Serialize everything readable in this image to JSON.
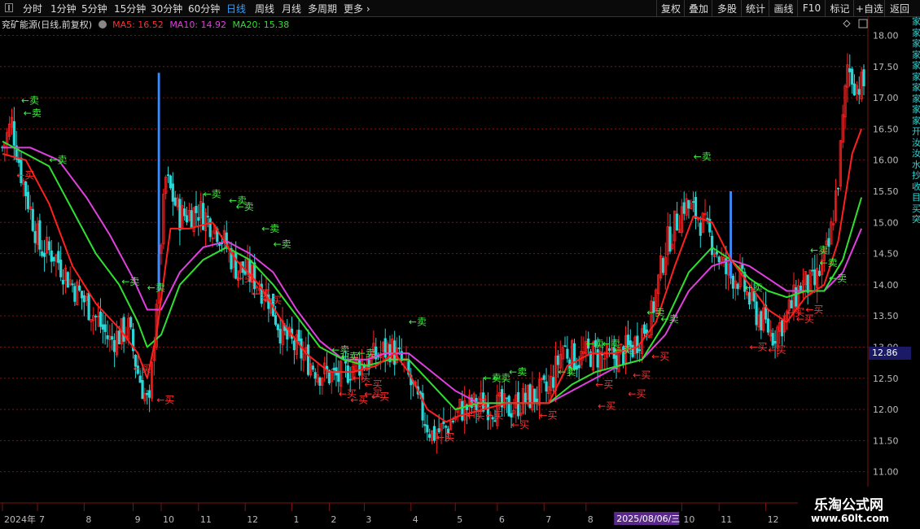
{
  "toolbar": {
    "timeframes": [
      "分时",
      "1分钟",
      "5分钟",
      "15分钟",
      "30分钟",
      "60分钟",
      "日线",
      "周线",
      "月线",
      "多周期",
      "更多 ›"
    ],
    "active_index": 6,
    "right_buttons": [
      "复权",
      "叠加",
      "多股",
      "统计",
      "画线",
      "F10",
      "标记",
      "+自选",
      "返回"
    ]
  },
  "info": {
    "title": "兖矿能源(日线,前复权)",
    "ma5_label": "MA5: 16.52",
    "ma10_label": "MA10: 14.92",
    "ma20_label": "MA20: 15.38"
  },
  "colors": {
    "up": "#ff2020",
    "down": "#2bd6d6",
    "ma5": "#ff2020",
    "ma10": "#e040e0",
    "ma20": "#30e030",
    "buy": "#ff3030",
    "sell": "#40ee40",
    "grid": "#7a1414",
    "axis_text": "#bbbbbb",
    "blue_spike": "#3a8cff"
  },
  "price_label": "12.86",
  "date_badge": "2025/08/06/三",
  "right_strip_chars": [
    "家",
    "家",
    "家",
    "家",
    "家",
    "家",
    "家",
    "家",
    "家",
    "家",
    "开",
    "汝",
    "汝",
    "水",
    "抄",
    "收",
    "目",
    "买",
    "突"
  ],
  "brand": {
    "name": "乐淘公式网",
    "url": "www.60lt.com"
  },
  "chart_data": {
    "type": "candlestick",
    "y_ticks": [
      "18.00",
      "17.50",
      "17.00",
      "16.50",
      "16.00",
      "15.50",
      "15.00",
      "14.50",
      "14.00",
      "13.50",
      "13.00",
      "12.50",
      "12.00",
      "11.50",
      "11.00"
    ],
    "ylim": [
      10.8,
      18.15
    ],
    "x_labels": [
      {
        "label": "2024年",
        "t": 0
      },
      {
        "label": "7",
        "t": 15
      },
      {
        "label": "8",
        "t": 35
      },
      {
        "label": "9",
        "t": 56
      },
      {
        "label": "10",
        "t": 68
      },
      {
        "label": "11",
        "t": 84
      },
      {
        "label": "12",
        "t": 104
      },
      {
        "label": "1",
        "t": 124
      },
      {
        "label": "2",
        "t": 140
      },
      {
        "label": "3",
        "t": 155
      },
      {
        "label": "4",
        "t": 175
      },
      {
        "label": "5",
        "t": 194
      },
      {
        "label": "6",
        "t": 212
      },
      {
        "label": "7",
        "t": 232
      },
      {
        "label": "8",
        "t": 250
      },
      {
        "label": "10",
        "t": 291
      },
      {
        "label": "11",
        "t": 307
      },
      {
        "label": "12",
        "t": 327
      }
    ],
    "n_bars": 370,
    "price_path": [
      [
        0,
        16.2
      ],
      [
        4,
        16.6
      ],
      [
        8,
        15.8
      ],
      [
        12,
        15.2
      ],
      [
        16,
        14.6
      ],
      [
        22,
        14.5
      ],
      [
        30,
        14.0
      ],
      [
        38,
        13.6
      ],
      [
        46,
        13.1
      ],
      [
        54,
        13.3
      ],
      [
        58,
        12.6
      ],
      [
        63,
        12.0
      ],
      [
        66,
        13.8
      ],
      [
        70,
        15.7
      ],
      [
        76,
        15.1
      ],
      [
        84,
        15.2
      ],
      [
        92,
        14.9
      ],
      [
        100,
        14.3
      ],
      [
        108,
        14.1
      ],
      [
        114,
        13.8
      ],
      [
        120,
        13.2
      ],
      [
        128,
        12.9
      ],
      [
        136,
        12.6
      ],
      [
        144,
        12.5
      ],
      [
        150,
        12.7
      ],
      [
        158,
        12.8
      ],
      [
        166,
        13.0
      ],
      [
        172,
        12.7
      ],
      [
        178,
        12.1
      ],
      [
        184,
        11.6
      ],
      [
        190,
        11.7
      ],
      [
        196,
        12.0
      ],
      [
        206,
        12.1
      ],
      [
        216,
        12.0
      ],
      [
        226,
        12.2
      ],
      [
        234,
        12.3
      ],
      [
        240,
        13.0
      ],
      [
        246,
        12.8
      ],
      [
        252,
        12.9
      ],
      [
        260,
        12.8
      ],
      [
        270,
        13.0
      ],
      [
        278,
        13.5
      ],
      [
        284,
        14.6
      ],
      [
        292,
        15.3
      ],
      [
        298,
        15.1
      ],
      [
        304,
        14.7
      ],
      [
        310,
        14.2
      ],
      [
        316,
        14.1
      ],
      [
        322,
        13.6
      ],
      [
        330,
        13.2
      ],
      [
        336,
        13.5
      ],
      [
        342,
        14.0
      ],
      [
        348,
        14.0
      ],
      [
        354,
        14.6
      ],
      [
        358,
        15.7
      ],
      [
        362,
        17.5
      ],
      [
        366,
        17.2
      ]
    ],
    "ma5": [
      [
        0,
        16.1
      ],
      [
        10,
        16.0
      ],
      [
        20,
        15.3
      ],
      [
        30,
        14.3
      ],
      [
        40,
        13.7
      ],
      [
        50,
        13.3
      ],
      [
        58,
        12.9
      ],
      [
        62,
        12.5
      ],
      [
        66,
        13.2
      ],
      [
        72,
        14.9
      ],
      [
        80,
        14.9
      ],
      [
        90,
        15.0
      ],
      [
        100,
        14.4
      ],
      [
        110,
        14.0
      ],
      [
        120,
        13.4
      ],
      [
        130,
        12.9
      ],
      [
        140,
        12.6
      ],
      [
        150,
        12.6
      ],
      [
        160,
        12.7
      ],
      [
        168,
        12.9
      ],
      [
        174,
        12.6
      ],
      [
        182,
        12.0
      ],
      [
        190,
        11.8
      ],
      [
        196,
        11.9
      ],
      [
        206,
        12.0
      ],
      [
        216,
        12.1
      ],
      [
        226,
        12.1
      ],
      [
        234,
        12.1
      ],
      [
        242,
        12.7
      ],
      [
        252,
        12.9
      ],
      [
        262,
        12.9
      ],
      [
        272,
        13.0
      ],
      [
        280,
        13.4
      ],
      [
        288,
        14.3
      ],
      [
        296,
        15.1
      ],
      [
        304,
        15.0
      ],
      [
        312,
        14.4
      ],
      [
        320,
        14.0
      ],
      [
        328,
        13.6
      ],
      [
        336,
        13.4
      ],
      [
        344,
        13.8
      ],
      [
        352,
        14.0
      ],
      [
        358,
        14.7
      ],
      [
        364,
        16.1
      ],
      [
        368,
        16.5
      ]
    ],
    "ma10": [
      [
        0,
        16.2
      ],
      [
        12,
        16.2
      ],
      [
        24,
        16.0
      ],
      [
        36,
        15.4
      ],
      [
        46,
        14.8
      ],
      [
        56,
        14.1
      ],
      [
        62,
        13.6
      ],
      [
        68,
        13.6
      ],
      [
        76,
        14.2
      ],
      [
        86,
        14.6
      ],
      [
        96,
        14.7
      ],
      [
        106,
        14.5
      ],
      [
        116,
        14.2
      ],
      [
        126,
        13.6
      ],
      [
        136,
        13.1
      ],
      [
        146,
        12.8
      ],
      [
        156,
        12.8
      ],
      [
        164,
        12.9
      ],
      [
        174,
        12.9
      ],
      [
        184,
        12.6
      ],
      [
        194,
        12.3
      ],
      [
        204,
        12.1
      ],
      [
        214,
        12.1
      ],
      [
        224,
        12.1
      ],
      [
        234,
        12.1
      ],
      [
        244,
        12.3
      ],
      [
        254,
        12.5
      ],
      [
        264,
        12.7
      ],
      [
        274,
        12.8
      ],
      [
        284,
        13.2
      ],
      [
        294,
        13.9
      ],
      [
        304,
        14.3
      ],
      [
        312,
        14.4
      ],
      [
        320,
        14.3
      ],
      [
        328,
        14.1
      ],
      [
        336,
        13.9
      ],
      [
        344,
        13.9
      ],
      [
        352,
        13.9
      ],
      [
        360,
        14.2
      ],
      [
        368,
        14.9
      ]
    ],
    "ma20": [
      [
        0,
        16.3
      ],
      [
        10,
        16.1
      ],
      [
        20,
        15.9
      ],
      [
        30,
        15.2
      ],
      [
        40,
        14.5
      ],
      [
        50,
        14.0
      ],
      [
        58,
        13.4
      ],
      [
        62,
        13.0
      ],
      [
        68,
        13.2
      ],
      [
        76,
        14.0
      ],
      [
        86,
        14.4
      ],
      [
        96,
        14.6
      ],
      [
        106,
        14.4
      ],
      [
        116,
        14.0
      ],
      [
        126,
        13.5
      ],
      [
        136,
        13.0
      ],
      [
        146,
        12.8
      ],
      [
        156,
        12.7
      ],
      [
        166,
        12.8
      ],
      [
        174,
        12.8
      ],
      [
        184,
        12.4
      ],
      [
        194,
        12.0
      ],
      [
        204,
        12.1
      ],
      [
        214,
        12.1
      ],
      [
        224,
        12.1
      ],
      [
        234,
        12.1
      ],
      [
        244,
        12.4
      ],
      [
        254,
        12.6
      ],
      [
        264,
        12.7
      ],
      [
        274,
        12.8
      ],
      [
        284,
        13.4
      ],
      [
        294,
        14.2
      ],
      [
        304,
        14.6
      ],
      [
        312,
        14.4
      ],
      [
        320,
        14.1
      ],
      [
        328,
        13.9
      ],
      [
        336,
        13.8
      ],
      [
        344,
        13.9
      ],
      [
        352,
        13.9
      ],
      [
        360,
        14.4
      ],
      [
        368,
        15.4
      ]
    ],
    "blue_spikes": [
      [
        67,
        13.9,
        17.4
      ],
      [
        312,
        14.1,
        15.5
      ]
    ],
    "sell_labels": [
      [
        8,
        16.9
      ],
      [
        9,
        16.7
      ],
      [
        20,
        15.95
      ],
      [
        51,
        14.0
      ],
      [
        62,
        13.9
      ],
      [
        86,
        15.4
      ],
      [
        97,
        15.3
      ],
      [
        100,
        15.2
      ],
      [
        111,
        14.85
      ],
      [
        116,
        14.6
      ],
      [
        141,
        12.9
      ],
      [
        145,
        12.8
      ],
      [
        152,
        12.85
      ],
      [
        174,
        13.35
      ],
      [
        206,
        12.45
      ],
      [
        210,
        12.45
      ],
      [
        217,
        12.55
      ],
      [
        238,
        12.55
      ],
      [
        250,
        13.0
      ],
      [
        257,
        13.0
      ],
      [
        262,
        12.9
      ],
      [
        276,
        13.5
      ],
      [
        282,
        13.4
      ],
      [
        296,
        16.0
      ],
      [
        318,
        13.9
      ],
      [
        346,
        14.5
      ],
      [
        350,
        14.3
      ],
      [
        354,
        14.05
      ]
    ],
    "buy_labels": [
      [
        6,
        15.7
      ],
      [
        100,
        14.05
      ],
      [
        112,
        13.7
      ],
      [
        107,
        13.8
      ],
      [
        56,
        12.6
      ],
      [
        66,
        12.1
      ],
      [
        144,
        12.2
      ],
      [
        149,
        12.1
      ],
      [
        155,
        12.2
      ],
      [
        150,
        12.45
      ],
      [
        155,
        12.35
      ],
      [
        158,
        12.15
      ],
      [
        186,
        11.5
      ],
      [
        199,
        11.85
      ],
      [
        200,
        12.05
      ],
      [
        207,
        11.85
      ],
      [
        218,
        11.7
      ],
      [
        230,
        11.85
      ],
      [
        254,
        12.35
      ],
      [
        270,
        12.5
      ],
      [
        255,
        12.0
      ],
      [
        268,
        12.2
      ],
      [
        278,
        12.8
      ],
      [
        320,
        12.95
      ],
      [
        328,
        12.9
      ],
      [
        336,
        13.5
      ],
      [
        340,
        13.4
      ],
      [
        344,
        13.55
      ]
    ]
  }
}
